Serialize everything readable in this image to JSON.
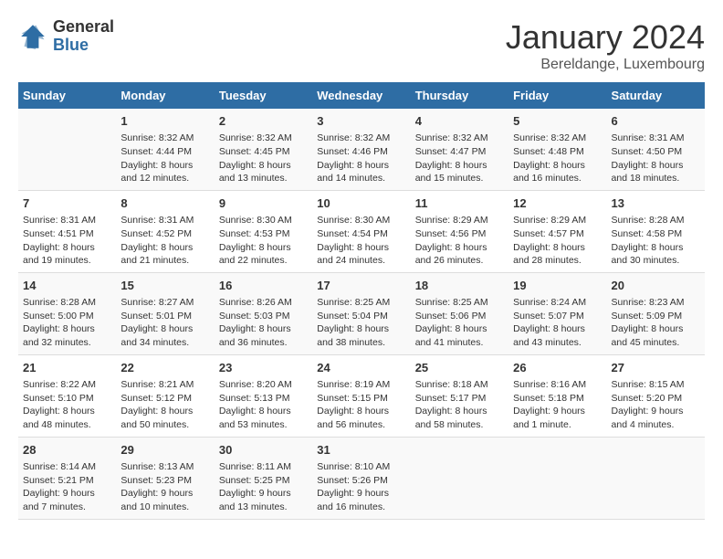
{
  "logo": {
    "general": "General",
    "blue": "Blue"
  },
  "title": "January 2024",
  "location": "Bereldange, Luxembourg",
  "days_of_week": [
    "Sunday",
    "Monday",
    "Tuesday",
    "Wednesday",
    "Thursday",
    "Friday",
    "Saturday"
  ],
  "weeks": [
    [
      {
        "day": "",
        "sunrise": "",
        "sunset": "",
        "daylight": ""
      },
      {
        "day": "1",
        "sunrise": "Sunrise: 8:32 AM",
        "sunset": "Sunset: 4:44 PM",
        "daylight": "Daylight: 8 hours and 12 minutes."
      },
      {
        "day": "2",
        "sunrise": "Sunrise: 8:32 AM",
        "sunset": "Sunset: 4:45 PM",
        "daylight": "Daylight: 8 hours and 13 minutes."
      },
      {
        "day": "3",
        "sunrise": "Sunrise: 8:32 AM",
        "sunset": "Sunset: 4:46 PM",
        "daylight": "Daylight: 8 hours and 14 minutes."
      },
      {
        "day": "4",
        "sunrise": "Sunrise: 8:32 AM",
        "sunset": "Sunset: 4:47 PM",
        "daylight": "Daylight: 8 hours and 15 minutes."
      },
      {
        "day": "5",
        "sunrise": "Sunrise: 8:32 AM",
        "sunset": "Sunset: 4:48 PM",
        "daylight": "Daylight: 8 hours and 16 minutes."
      },
      {
        "day": "6",
        "sunrise": "Sunrise: 8:31 AM",
        "sunset": "Sunset: 4:50 PM",
        "daylight": "Daylight: 8 hours and 18 minutes."
      }
    ],
    [
      {
        "day": "7",
        "sunrise": "Sunrise: 8:31 AM",
        "sunset": "Sunset: 4:51 PM",
        "daylight": "Daylight: 8 hours and 19 minutes."
      },
      {
        "day": "8",
        "sunrise": "Sunrise: 8:31 AM",
        "sunset": "Sunset: 4:52 PM",
        "daylight": "Daylight: 8 hours and 21 minutes."
      },
      {
        "day": "9",
        "sunrise": "Sunrise: 8:30 AM",
        "sunset": "Sunset: 4:53 PM",
        "daylight": "Daylight: 8 hours and 22 minutes."
      },
      {
        "day": "10",
        "sunrise": "Sunrise: 8:30 AM",
        "sunset": "Sunset: 4:54 PM",
        "daylight": "Daylight: 8 hours and 24 minutes."
      },
      {
        "day": "11",
        "sunrise": "Sunrise: 8:29 AM",
        "sunset": "Sunset: 4:56 PM",
        "daylight": "Daylight: 8 hours and 26 minutes."
      },
      {
        "day": "12",
        "sunrise": "Sunrise: 8:29 AM",
        "sunset": "Sunset: 4:57 PM",
        "daylight": "Daylight: 8 hours and 28 minutes."
      },
      {
        "day": "13",
        "sunrise": "Sunrise: 8:28 AM",
        "sunset": "Sunset: 4:58 PM",
        "daylight": "Daylight: 8 hours and 30 minutes."
      }
    ],
    [
      {
        "day": "14",
        "sunrise": "Sunrise: 8:28 AM",
        "sunset": "Sunset: 5:00 PM",
        "daylight": "Daylight: 8 hours and 32 minutes."
      },
      {
        "day": "15",
        "sunrise": "Sunrise: 8:27 AM",
        "sunset": "Sunset: 5:01 PM",
        "daylight": "Daylight: 8 hours and 34 minutes."
      },
      {
        "day": "16",
        "sunrise": "Sunrise: 8:26 AM",
        "sunset": "Sunset: 5:03 PM",
        "daylight": "Daylight: 8 hours and 36 minutes."
      },
      {
        "day": "17",
        "sunrise": "Sunrise: 8:25 AM",
        "sunset": "Sunset: 5:04 PM",
        "daylight": "Daylight: 8 hours and 38 minutes."
      },
      {
        "day": "18",
        "sunrise": "Sunrise: 8:25 AM",
        "sunset": "Sunset: 5:06 PM",
        "daylight": "Daylight: 8 hours and 41 minutes."
      },
      {
        "day": "19",
        "sunrise": "Sunrise: 8:24 AM",
        "sunset": "Sunset: 5:07 PM",
        "daylight": "Daylight: 8 hours and 43 minutes."
      },
      {
        "day": "20",
        "sunrise": "Sunrise: 8:23 AM",
        "sunset": "Sunset: 5:09 PM",
        "daylight": "Daylight: 8 hours and 45 minutes."
      }
    ],
    [
      {
        "day": "21",
        "sunrise": "Sunrise: 8:22 AM",
        "sunset": "Sunset: 5:10 PM",
        "daylight": "Daylight: 8 hours and 48 minutes."
      },
      {
        "day": "22",
        "sunrise": "Sunrise: 8:21 AM",
        "sunset": "Sunset: 5:12 PM",
        "daylight": "Daylight: 8 hours and 50 minutes."
      },
      {
        "day": "23",
        "sunrise": "Sunrise: 8:20 AM",
        "sunset": "Sunset: 5:13 PM",
        "daylight": "Daylight: 8 hours and 53 minutes."
      },
      {
        "day": "24",
        "sunrise": "Sunrise: 8:19 AM",
        "sunset": "Sunset: 5:15 PM",
        "daylight": "Daylight: 8 hours and 56 minutes."
      },
      {
        "day": "25",
        "sunrise": "Sunrise: 8:18 AM",
        "sunset": "Sunset: 5:17 PM",
        "daylight": "Daylight: 8 hours and 58 minutes."
      },
      {
        "day": "26",
        "sunrise": "Sunrise: 8:16 AM",
        "sunset": "Sunset: 5:18 PM",
        "daylight": "Daylight: 9 hours and 1 minute."
      },
      {
        "day": "27",
        "sunrise": "Sunrise: 8:15 AM",
        "sunset": "Sunset: 5:20 PM",
        "daylight": "Daylight: 9 hours and 4 minutes."
      }
    ],
    [
      {
        "day": "28",
        "sunrise": "Sunrise: 8:14 AM",
        "sunset": "Sunset: 5:21 PM",
        "daylight": "Daylight: 9 hours and 7 minutes."
      },
      {
        "day": "29",
        "sunrise": "Sunrise: 8:13 AM",
        "sunset": "Sunset: 5:23 PM",
        "daylight": "Daylight: 9 hours and 10 minutes."
      },
      {
        "day": "30",
        "sunrise": "Sunrise: 8:11 AM",
        "sunset": "Sunset: 5:25 PM",
        "daylight": "Daylight: 9 hours and 13 minutes."
      },
      {
        "day": "31",
        "sunrise": "Sunrise: 8:10 AM",
        "sunset": "Sunset: 5:26 PM",
        "daylight": "Daylight: 9 hours and 16 minutes."
      },
      {
        "day": "",
        "sunrise": "",
        "sunset": "",
        "daylight": ""
      },
      {
        "day": "",
        "sunrise": "",
        "sunset": "",
        "daylight": ""
      },
      {
        "day": "",
        "sunrise": "",
        "sunset": "",
        "daylight": ""
      }
    ]
  ]
}
